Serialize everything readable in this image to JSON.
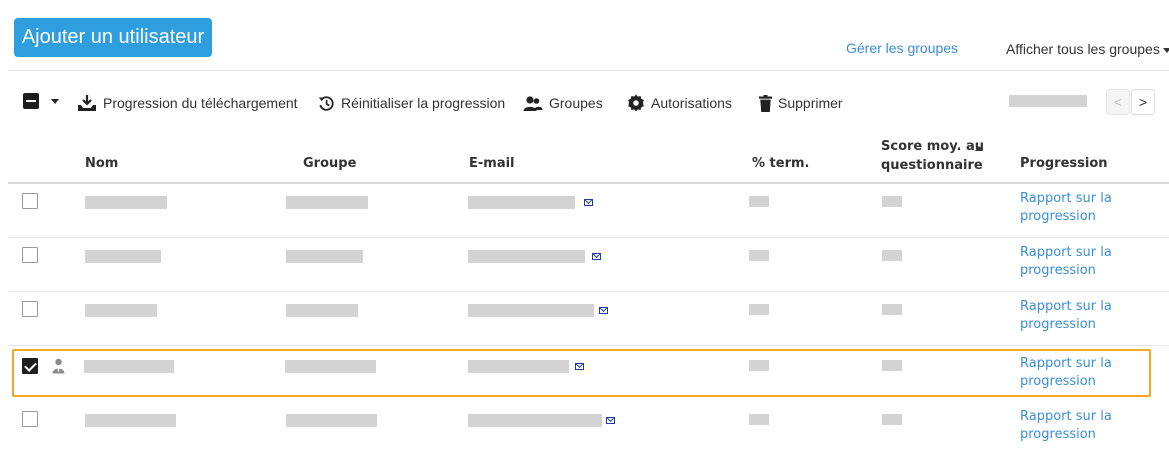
{
  "header": {
    "add_user_label": "Ajouter un utilisateur",
    "manage_groups_label": "Gérer les groupes",
    "show_groups_label": "Afficher tous les groupes"
  },
  "toolbar": {
    "download_progress_label": "Progression du téléchargement",
    "reset_progress_label": "Réinitialiser la progression",
    "groups_label": "Groupes",
    "permissions_label": "Autorisations",
    "delete_label": "Supprimer",
    "prev_label": "<",
    "next_label": ">"
  },
  "table": {
    "columns": {
      "name": "Nom",
      "group": "Groupe",
      "email": "E-mail",
      "completed": "% term.",
      "quiz_score_line1": "Score moy. au",
      "quiz_score_line2": "questionnaire",
      "progress": "Progression"
    },
    "report_link_line1": "Rapport sur la",
    "report_link_line2": "progression",
    "rows": [
      {
        "checked": false,
        "has_user_icon": false
      },
      {
        "checked": false,
        "has_user_icon": false
      },
      {
        "checked": false,
        "has_user_icon": false
      },
      {
        "checked": true,
        "has_user_icon": true
      },
      {
        "checked": false,
        "has_user_icon": false
      }
    ]
  },
  "colors": {
    "primary_button": "#2e9ede",
    "link": "#3a8fd6",
    "highlight": "#f2a623",
    "redacted": "#d3d3d3"
  }
}
